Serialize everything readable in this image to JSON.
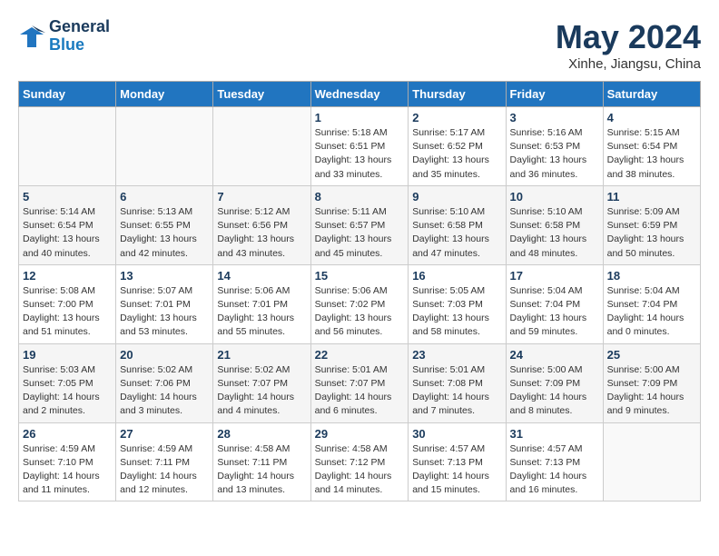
{
  "header": {
    "logo_line1": "General",
    "logo_line2": "Blue",
    "month_year": "May 2024",
    "location": "Xinhe, Jiangsu, China"
  },
  "weekdays": [
    "Sunday",
    "Monday",
    "Tuesday",
    "Wednesday",
    "Thursday",
    "Friday",
    "Saturday"
  ],
  "weeks": [
    [
      {
        "date": "",
        "info": ""
      },
      {
        "date": "",
        "info": ""
      },
      {
        "date": "",
        "info": ""
      },
      {
        "date": "1",
        "info": "Sunrise: 5:18 AM\nSunset: 6:51 PM\nDaylight: 13 hours\nand 33 minutes."
      },
      {
        "date": "2",
        "info": "Sunrise: 5:17 AM\nSunset: 6:52 PM\nDaylight: 13 hours\nand 35 minutes."
      },
      {
        "date": "3",
        "info": "Sunrise: 5:16 AM\nSunset: 6:53 PM\nDaylight: 13 hours\nand 36 minutes."
      },
      {
        "date": "4",
        "info": "Sunrise: 5:15 AM\nSunset: 6:54 PM\nDaylight: 13 hours\nand 38 minutes."
      }
    ],
    [
      {
        "date": "5",
        "info": "Sunrise: 5:14 AM\nSunset: 6:54 PM\nDaylight: 13 hours\nand 40 minutes."
      },
      {
        "date": "6",
        "info": "Sunrise: 5:13 AM\nSunset: 6:55 PM\nDaylight: 13 hours\nand 42 minutes."
      },
      {
        "date": "7",
        "info": "Sunrise: 5:12 AM\nSunset: 6:56 PM\nDaylight: 13 hours\nand 43 minutes."
      },
      {
        "date": "8",
        "info": "Sunrise: 5:11 AM\nSunset: 6:57 PM\nDaylight: 13 hours\nand 45 minutes."
      },
      {
        "date": "9",
        "info": "Sunrise: 5:10 AM\nSunset: 6:58 PM\nDaylight: 13 hours\nand 47 minutes."
      },
      {
        "date": "10",
        "info": "Sunrise: 5:10 AM\nSunset: 6:58 PM\nDaylight: 13 hours\nand 48 minutes."
      },
      {
        "date": "11",
        "info": "Sunrise: 5:09 AM\nSunset: 6:59 PM\nDaylight: 13 hours\nand 50 minutes."
      }
    ],
    [
      {
        "date": "12",
        "info": "Sunrise: 5:08 AM\nSunset: 7:00 PM\nDaylight: 13 hours\nand 51 minutes."
      },
      {
        "date": "13",
        "info": "Sunrise: 5:07 AM\nSunset: 7:01 PM\nDaylight: 13 hours\nand 53 minutes."
      },
      {
        "date": "14",
        "info": "Sunrise: 5:06 AM\nSunset: 7:01 PM\nDaylight: 13 hours\nand 55 minutes."
      },
      {
        "date": "15",
        "info": "Sunrise: 5:06 AM\nSunset: 7:02 PM\nDaylight: 13 hours\nand 56 minutes."
      },
      {
        "date": "16",
        "info": "Sunrise: 5:05 AM\nSunset: 7:03 PM\nDaylight: 13 hours\nand 58 minutes."
      },
      {
        "date": "17",
        "info": "Sunrise: 5:04 AM\nSunset: 7:04 PM\nDaylight: 13 hours\nand 59 minutes."
      },
      {
        "date": "18",
        "info": "Sunrise: 5:04 AM\nSunset: 7:04 PM\nDaylight: 14 hours\nand 0 minutes."
      }
    ],
    [
      {
        "date": "19",
        "info": "Sunrise: 5:03 AM\nSunset: 7:05 PM\nDaylight: 14 hours\nand 2 minutes."
      },
      {
        "date": "20",
        "info": "Sunrise: 5:02 AM\nSunset: 7:06 PM\nDaylight: 14 hours\nand 3 minutes."
      },
      {
        "date": "21",
        "info": "Sunrise: 5:02 AM\nSunset: 7:07 PM\nDaylight: 14 hours\nand 4 minutes."
      },
      {
        "date": "22",
        "info": "Sunrise: 5:01 AM\nSunset: 7:07 PM\nDaylight: 14 hours\nand 6 minutes."
      },
      {
        "date": "23",
        "info": "Sunrise: 5:01 AM\nSunset: 7:08 PM\nDaylight: 14 hours\nand 7 minutes."
      },
      {
        "date": "24",
        "info": "Sunrise: 5:00 AM\nSunset: 7:09 PM\nDaylight: 14 hours\nand 8 minutes."
      },
      {
        "date": "25",
        "info": "Sunrise: 5:00 AM\nSunset: 7:09 PM\nDaylight: 14 hours\nand 9 minutes."
      }
    ],
    [
      {
        "date": "26",
        "info": "Sunrise: 4:59 AM\nSunset: 7:10 PM\nDaylight: 14 hours\nand 11 minutes."
      },
      {
        "date": "27",
        "info": "Sunrise: 4:59 AM\nSunset: 7:11 PM\nDaylight: 14 hours\nand 12 minutes."
      },
      {
        "date": "28",
        "info": "Sunrise: 4:58 AM\nSunset: 7:11 PM\nDaylight: 14 hours\nand 13 minutes."
      },
      {
        "date": "29",
        "info": "Sunrise: 4:58 AM\nSunset: 7:12 PM\nDaylight: 14 hours\nand 14 minutes."
      },
      {
        "date": "30",
        "info": "Sunrise: 4:57 AM\nSunset: 7:13 PM\nDaylight: 14 hours\nand 15 minutes."
      },
      {
        "date": "31",
        "info": "Sunrise: 4:57 AM\nSunset: 7:13 PM\nDaylight: 14 hours\nand 16 minutes."
      },
      {
        "date": "",
        "info": ""
      }
    ]
  ]
}
